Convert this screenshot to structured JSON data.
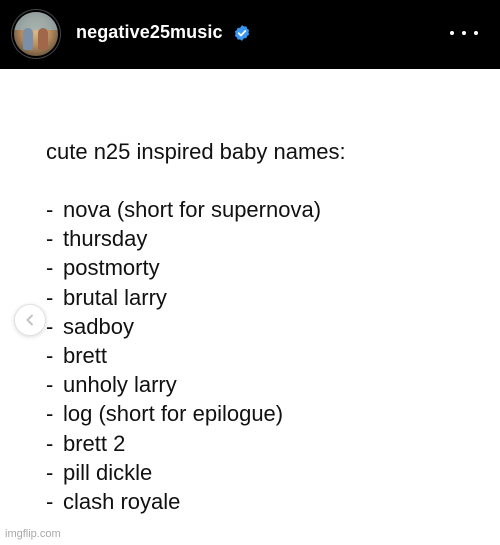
{
  "header": {
    "username": "negative25music",
    "verified_icon": "verified-badge-icon",
    "verified_color": "#3897f0",
    "more_icon": "more-options-icon"
  },
  "post": {
    "title": "cute n25 inspired baby names:",
    "names": [
      "nova (short for supernova)",
      "thursday",
      "postmorty",
      "brutal larry",
      "sadboy",
      "brett",
      "unholy larry",
      "log (short for epilogue)",
      "brett 2",
      "pill dickle",
      "clash royale"
    ],
    "bullet": "-",
    "carousel_prev_icon": "chevron-left-icon"
  },
  "watermark": "imgflip.com"
}
